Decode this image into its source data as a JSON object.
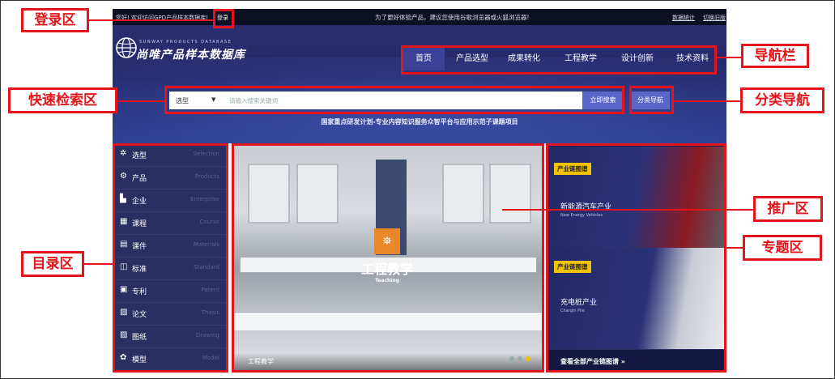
{
  "topbar": {
    "welcome": "您好! 欢迎访问GPD产品样本数据库!",
    "login": "登录",
    "notice": "为了更好体验产品，建议您使用谷歌浏览器或火狐浏览器!",
    "stats": "数据统计",
    "old_version": "切换旧版"
  },
  "logo": {
    "en": "SUNWAY PRODUCTS DATABASE",
    "cn": "尚唯产品样本数据库"
  },
  "nav": {
    "items": [
      "首页",
      "产品选型",
      "成果转化",
      "工程教学",
      "设计创新",
      "技术资料"
    ],
    "active_index": 0
  },
  "search": {
    "select_value": "选型",
    "placeholder": "请输入搜索关键词",
    "button": "立即搜索"
  },
  "category_nav": "分类导航",
  "project_text": "国家重点研发计划-专业内容知识服务众智平台与应用示范子课题项目",
  "sidebar": {
    "items": [
      {
        "cn": "选型",
        "en": "Selection",
        "icon": "selection-icon"
      },
      {
        "cn": "产品",
        "en": "Products",
        "icon": "product-icon"
      },
      {
        "cn": "企业",
        "en": "Enterprise",
        "icon": "enterprise-icon"
      },
      {
        "cn": "课程",
        "en": "Course",
        "icon": "course-icon"
      },
      {
        "cn": "课件",
        "en": "Materials",
        "icon": "materials-icon"
      },
      {
        "cn": "标准",
        "en": "Standard",
        "icon": "standard-icon"
      },
      {
        "cn": "专利",
        "en": "Patent",
        "icon": "patent-icon"
      },
      {
        "cn": "论文",
        "en": "Thesis",
        "icon": "thesis-icon"
      },
      {
        "cn": "图纸",
        "en": "Drawing",
        "icon": "drawing-icon"
      },
      {
        "cn": "模型",
        "en": "Model",
        "icon": "model-icon"
      }
    ]
  },
  "promo": {
    "title": "工程教学",
    "subtitle": "Teaching",
    "caption": "工程教学",
    "dots": 3,
    "active_dot": 2
  },
  "topics": {
    "cards": [
      {
        "tag": "产业链图谱",
        "cn": "新能源汽车产业",
        "en": "New Energy Vehicles"
      },
      {
        "tag": "产业链图谱",
        "cn": "充电桩产业",
        "en": "Chargin Pile"
      }
    ],
    "all_link": "查看全部产业链图谱  »"
  },
  "annotations": {
    "login_area": "登录区",
    "nav_bar": "导航栏",
    "quick_search": "快速检索区",
    "category_nav": "分类导航",
    "promo_area": "推广区",
    "catalog_area": "目录区",
    "topic_area": "专题区"
  },
  "colors": {
    "accent_red": "#e3141b",
    "header_blue": "#2b2e6e",
    "button_blue": "#5a66c8",
    "tag_yellow": "#f2c100"
  }
}
